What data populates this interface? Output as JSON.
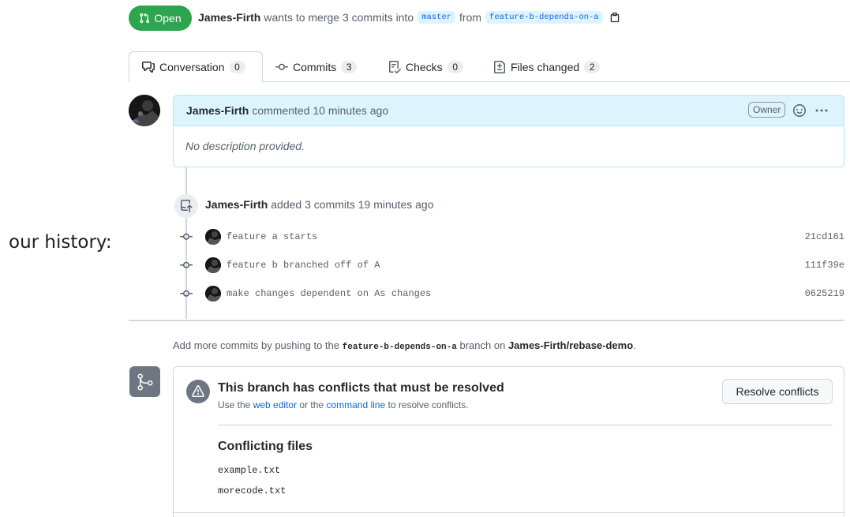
{
  "caption": "our history:",
  "pr": {
    "state": "Open",
    "author": "James-Firth",
    "merge_text": "wants to merge 3 commits into",
    "base_branch": "master",
    "from_text": "from",
    "head_branch": "feature-b-depends-on-a"
  },
  "tabs": [
    {
      "label": "Conversation",
      "count": "0"
    },
    {
      "label": "Commits",
      "count": "3"
    },
    {
      "label": "Checks",
      "count": "0"
    },
    {
      "label": "Files changed",
      "count": "2"
    }
  ],
  "comment": {
    "author": "James-Firth",
    "meta": "commented 10 minutes ago",
    "badge": "Owner",
    "body": "No description provided."
  },
  "timeline": {
    "author": "James-Firth",
    "text": "added 3 commits 19 minutes ago",
    "commits": [
      {
        "message": "feature a starts",
        "sha": "21cd161"
      },
      {
        "message": "feature b branched off of A",
        "sha": "111f39e"
      },
      {
        "message": "make changes dependent on As changes",
        "sha": "0625219"
      }
    ]
  },
  "add_more": {
    "prefix": "Add more commits by pushing to the",
    "branch": "feature-b-depends-on-a",
    "middle": "branch on",
    "repo": "James-Firth/rebase-demo",
    "suffix": "."
  },
  "merge": {
    "title": "This branch has conflicts that must be resolved",
    "sub_prefix": "Use the",
    "link1": "web editor",
    "sub_middle": "or the",
    "link2": "command line",
    "sub_suffix": "to resolve conflicts.",
    "button": "Resolve conflicts",
    "files_title": "Conflicting files",
    "files": [
      "example.txt",
      "morecode.txt"
    ]
  },
  "colors": {
    "open_green": "#2da44e",
    "link_blue": "#0969da",
    "comment_header": "#ddf4ff"
  }
}
